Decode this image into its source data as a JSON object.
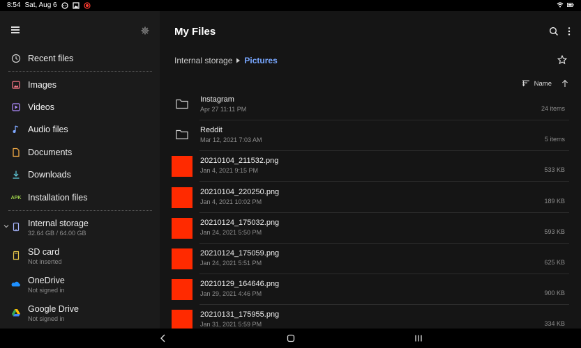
{
  "status": {
    "time": "8:54",
    "date": "Sat, Aug 6"
  },
  "sidebar": {
    "items": [
      {
        "label": "Recent files"
      },
      {
        "label": "Images"
      },
      {
        "label": "Videos"
      },
      {
        "label": "Audio files"
      },
      {
        "label": "Documents"
      },
      {
        "label": "Downloads"
      },
      {
        "label": "Installation files",
        "icon_text": "APK"
      },
      {
        "label": "Internal storage",
        "sub": "32.64 GB / 64.00 GB"
      },
      {
        "label": "SD card",
        "sub": "Not inserted"
      },
      {
        "label": "OneDrive",
        "sub": "Not signed in"
      },
      {
        "label": "Google Drive",
        "sub": "Not signed in"
      }
    ]
  },
  "main": {
    "title": "My Files",
    "breadcrumb": [
      "Internal storage",
      "Pictures"
    ],
    "sort_label": "Name",
    "files": [
      {
        "name": "Instagram",
        "date": "Apr 27 11:11 PM",
        "meta": "24 items",
        "kind": "folder"
      },
      {
        "name": "Reddit",
        "date": "Mar 12, 2021 7:03 AM",
        "meta": "5 items",
        "kind": "folder"
      },
      {
        "name": "20210104_211532.png",
        "date": "Jan 4, 2021 9:15 PM",
        "meta": "533 KB",
        "kind": "image"
      },
      {
        "name": "20210104_220250.png",
        "date": "Jan 4, 2021 10:02 PM",
        "meta": "189 KB",
        "kind": "image"
      },
      {
        "name": "20210124_175032.png",
        "date": "Jan 24, 2021 5:50 PM",
        "meta": "593 KB",
        "kind": "image"
      },
      {
        "name": "20210124_175059.png",
        "date": "Jan 24, 2021 5:51 PM",
        "meta": "625 KB",
        "kind": "image"
      },
      {
        "name": "20210129_164646.png",
        "date": "Jan 29, 2021 4:46 PM",
        "meta": "900 KB",
        "kind": "image"
      },
      {
        "name": "20210131_175955.png",
        "date": "Jan 31, 2021 5:59 PM",
        "meta": "334 KB",
        "kind": "image"
      }
    ]
  },
  "colors": {
    "accent": "#78a7ff",
    "thumb": "#ff2a00",
    "sidebar_bg": "#1b1b1b",
    "main_bg": "#151515"
  }
}
